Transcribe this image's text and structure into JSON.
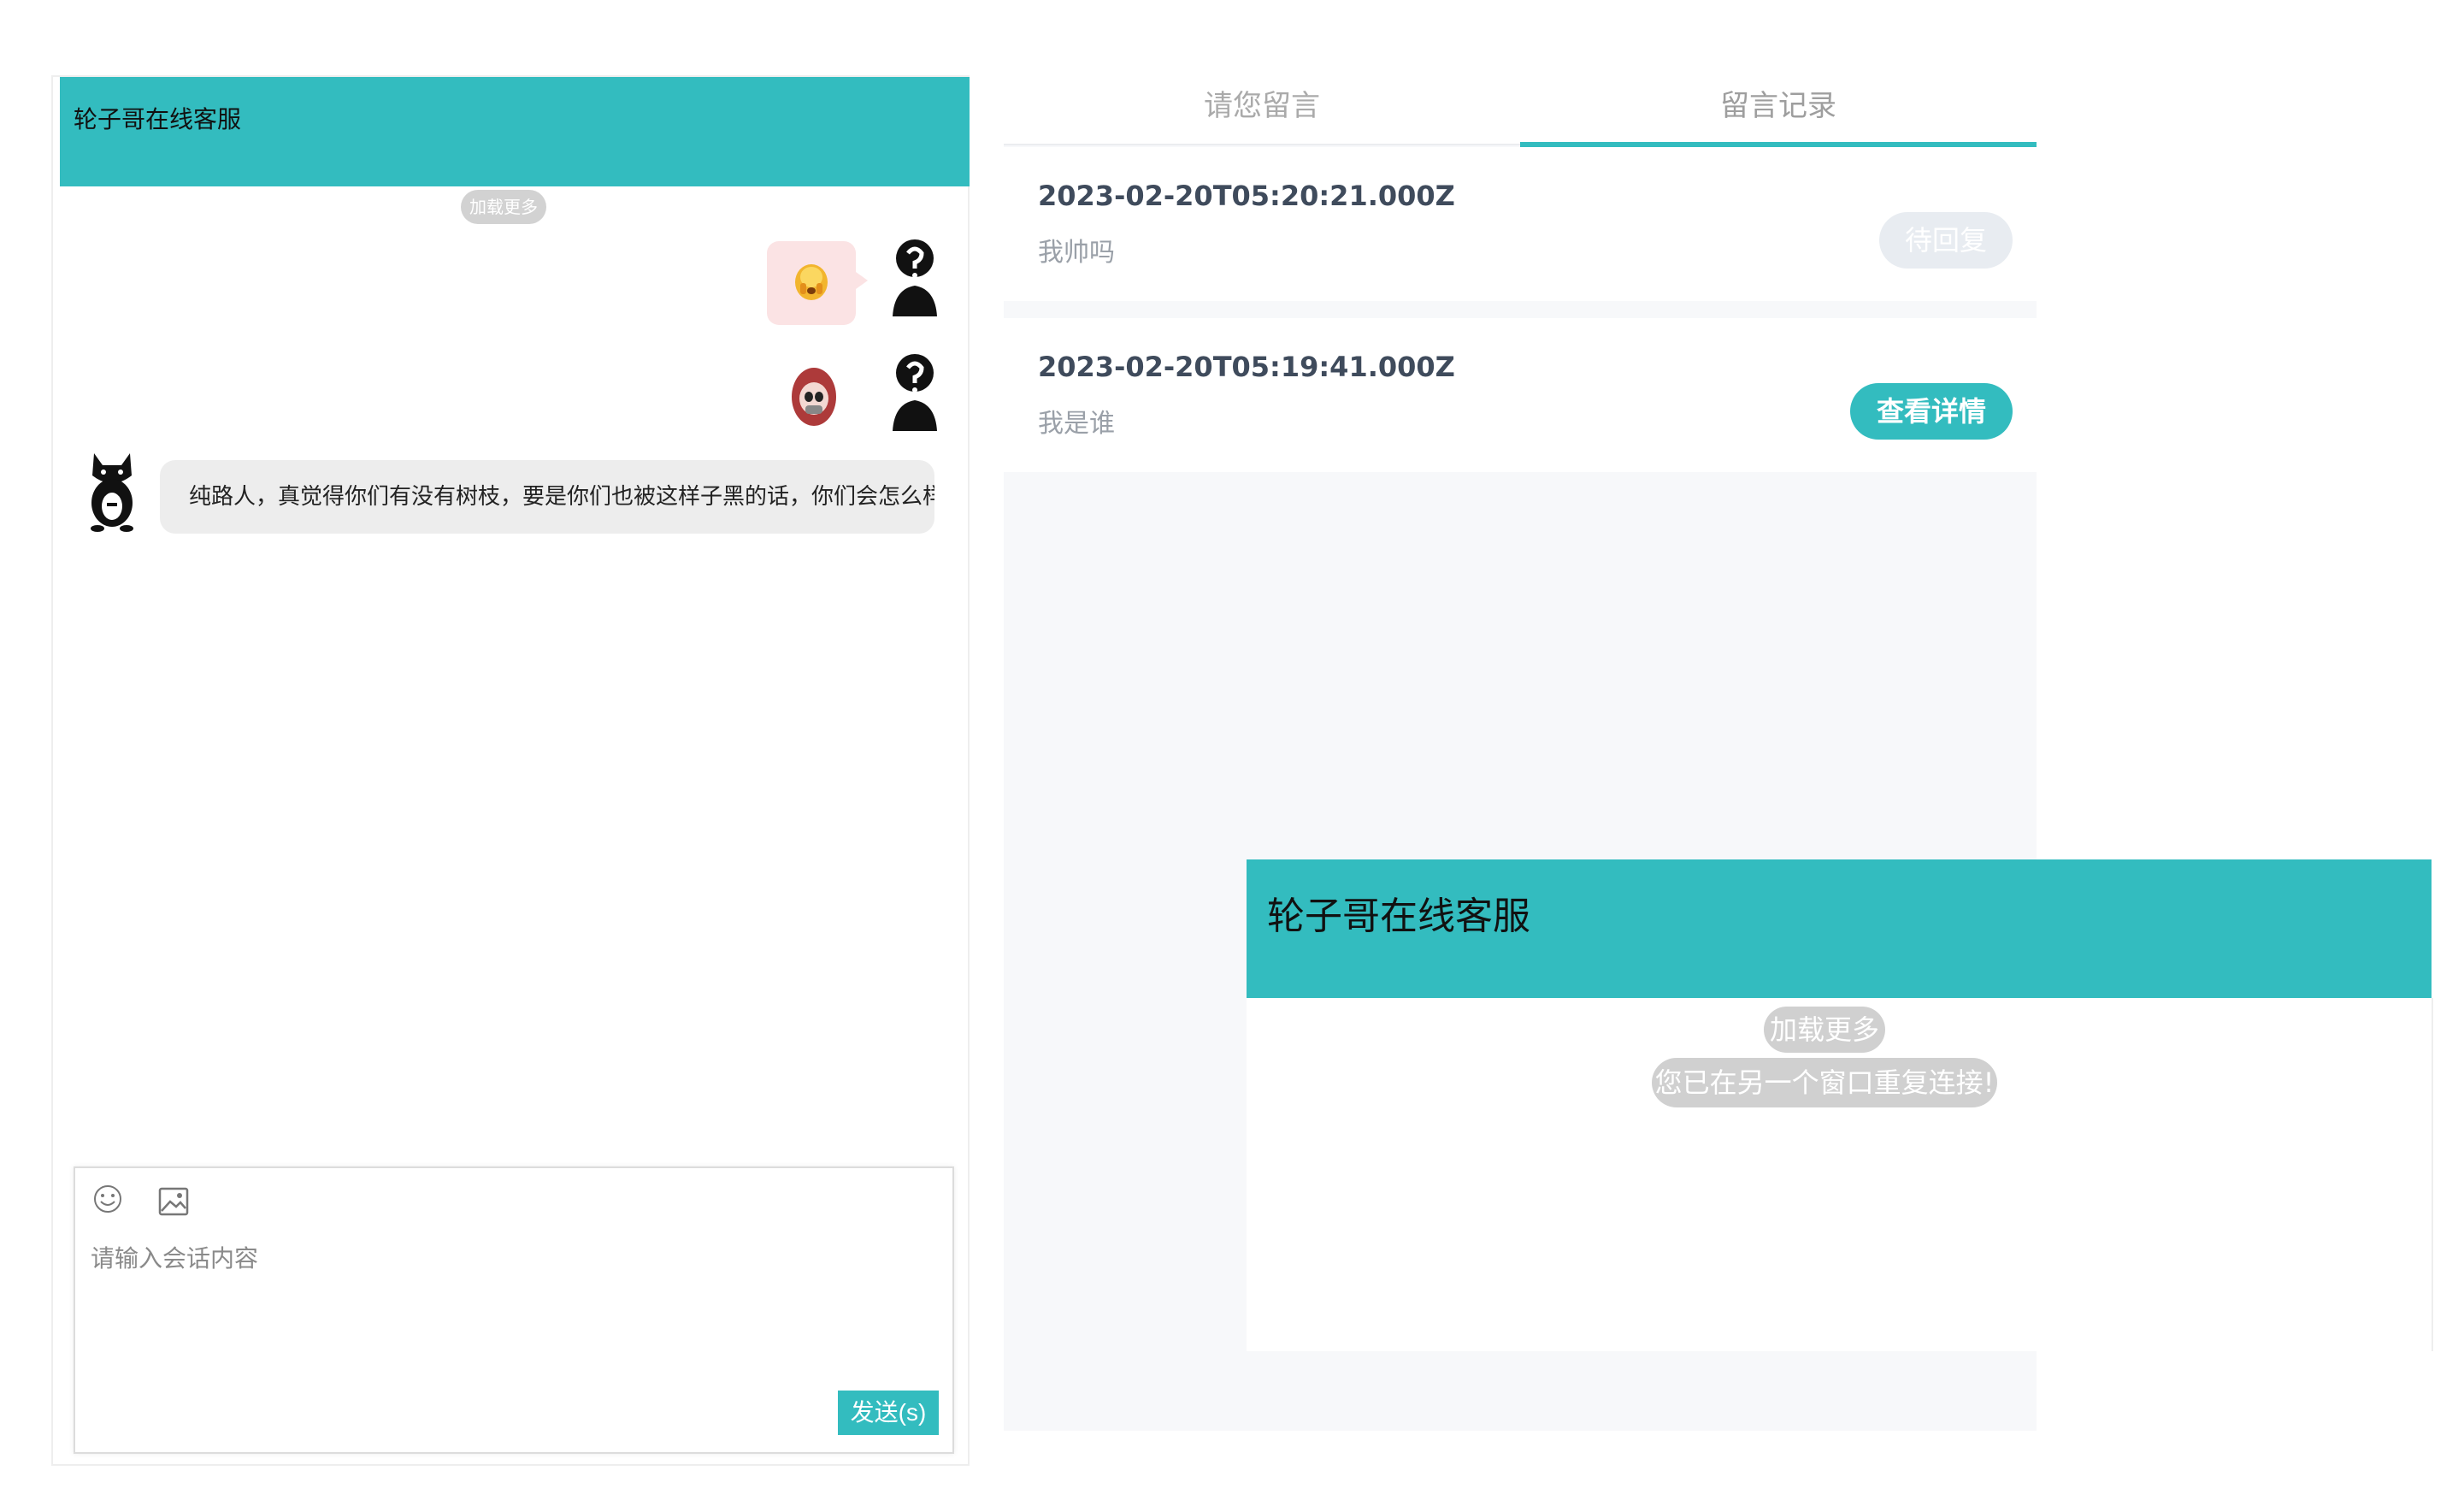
{
  "chat_left": {
    "title": "轮子哥在线客服",
    "load_more": "加载更多",
    "received_message": "纯路人，真觉得你们有没有树枝，要是你们也被这样子黑的话，你们会怎么样?",
    "composer": {
      "placeholder": "请输入会话内容",
      "send_label": "发送(s)"
    }
  },
  "message_panel": {
    "tabs": [
      {
        "label": "请您留言"
      },
      {
        "label": "留言记录"
      }
    ],
    "active_tab": 1,
    "records": [
      {
        "time": "2023-02-20T05:20:21.000Z",
        "message": "我帅吗",
        "action": "待回复"
      },
      {
        "time": "2023-02-20T05:19:41.000Z",
        "message": "我是谁",
        "action": "查看详情"
      }
    ]
  },
  "chat_right": {
    "title": "轮子哥在线客服",
    "load_more": "加载更多",
    "notice": "您已在另一个窗口重复连接!"
  },
  "colors": {
    "accent": "#33bcbf",
    "emoji_bubble": "#fbe3e4",
    "text_bubble": "#ededed",
    "pill": "#d0d0d0",
    "pending_button": "#e8ecf1"
  }
}
